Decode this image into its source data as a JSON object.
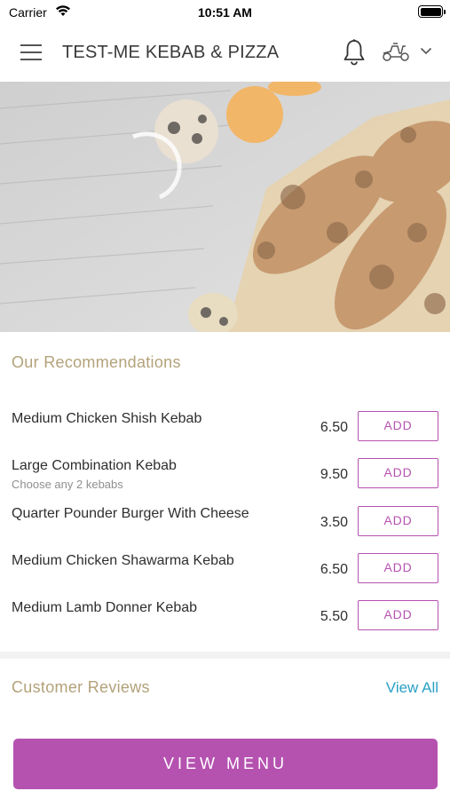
{
  "status_bar": {
    "carrier": "Carrier",
    "time": "10:51 AM",
    "icons": [
      "wifi-icon",
      "battery-icon"
    ]
  },
  "header": {
    "title": "TEST-ME KEBAB & PIZZA",
    "icons": [
      "menu-icon",
      "bell-icon",
      "scooter-icon",
      "chevron-down-icon"
    ]
  },
  "hero": {
    "description_icon": "kebab-food-photo"
  },
  "recommendations": {
    "title": "Our Recommendations",
    "items": [
      {
        "name": "Medium Chicken Shish Kebab",
        "note": "",
        "price": "6.50",
        "button": "ADD"
      },
      {
        "name": "Large Combination Kebab",
        "note": "Choose any 2 kebabs",
        "price": "9.50",
        "button": "ADD"
      },
      {
        "name": "Quarter Pounder Burger With Cheese",
        "note": "",
        "price": "3.50",
        "button": "ADD"
      },
      {
        "name": "Medium Chicken Shawarma Kebab",
        "note": "",
        "price": "6.50",
        "button": "ADD"
      },
      {
        "name": "Medium Lamb Donner Kebab",
        "note": "",
        "price": "5.50",
        "button": "ADD"
      }
    ]
  },
  "reviews": {
    "title": "Customer Reviews",
    "view_all": "View All"
  },
  "footer": {
    "view_menu": "VIEW MENU"
  },
  "colors": {
    "accent": "#b552b0",
    "section_title": "#b3a27a",
    "link": "#2aa0c5"
  }
}
